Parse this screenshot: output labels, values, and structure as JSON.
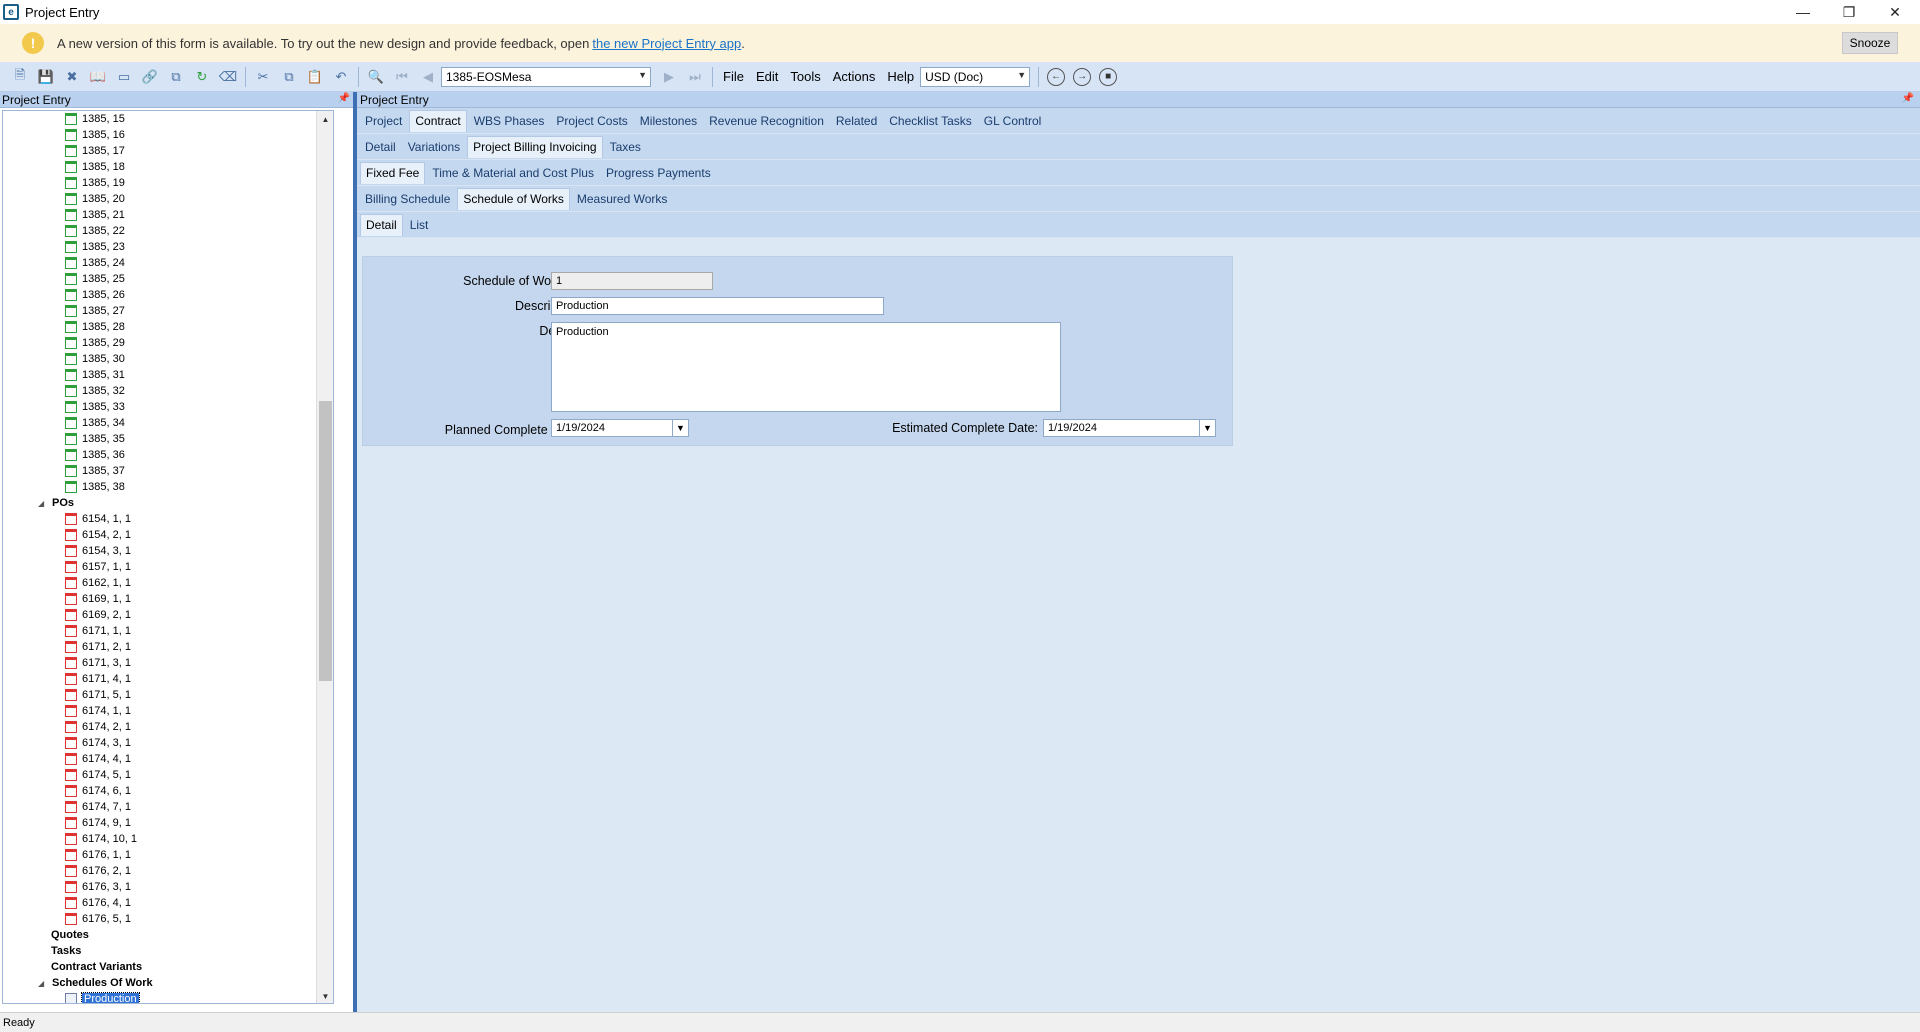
{
  "window": {
    "title": "Project Entry"
  },
  "banner": {
    "text": "A new version of this form is available. To try out the new design and provide feedback, open",
    "link": "the new Project Entry app",
    "suffix": ".",
    "snooze": "Snooze"
  },
  "toolbar": {
    "record_value": "1385-EOSMesa",
    "currency_value": "USD (Doc)",
    "menus": [
      "File",
      "Edit",
      "Tools",
      "Actions",
      "Help"
    ]
  },
  "left_pane": {
    "title": "Project Entry",
    "tree": [
      {
        "label": "1385, 15",
        "type": "green"
      },
      {
        "label": "1385, 16",
        "type": "green"
      },
      {
        "label": "1385, 17",
        "type": "green"
      },
      {
        "label": "1385, 18",
        "type": "green"
      },
      {
        "label": "1385, 19",
        "type": "green"
      },
      {
        "label": "1385, 20",
        "type": "green"
      },
      {
        "label": "1385, 21",
        "type": "green"
      },
      {
        "label": "1385, 22",
        "type": "green"
      },
      {
        "label": "1385, 23",
        "type": "green"
      },
      {
        "label": "1385, 24",
        "type": "green"
      },
      {
        "label": "1385, 25",
        "type": "green"
      },
      {
        "label": "1385, 26",
        "type": "green"
      },
      {
        "label": "1385, 27",
        "type": "green"
      },
      {
        "label": "1385, 28",
        "type": "green"
      },
      {
        "label": "1385, 29",
        "type": "green"
      },
      {
        "label": "1385, 30",
        "type": "green"
      },
      {
        "label": "1385, 31",
        "type": "green"
      },
      {
        "label": "1385, 32",
        "type": "green"
      },
      {
        "label": "1385, 33",
        "type": "green"
      },
      {
        "label": "1385, 34",
        "type": "green"
      },
      {
        "label": "1385, 35",
        "type": "green"
      },
      {
        "label": "1385, 36",
        "type": "green"
      },
      {
        "label": "1385, 37",
        "type": "green"
      },
      {
        "label": "1385, 38",
        "type": "green"
      },
      {
        "label": "POs",
        "type": "group"
      },
      {
        "label": "6154, 1, 1",
        "type": "red"
      },
      {
        "label": "6154, 2, 1",
        "type": "red"
      },
      {
        "label": "6154, 3, 1",
        "type": "red"
      },
      {
        "label": "6157, 1, 1",
        "type": "red"
      },
      {
        "label": "6162, 1, 1",
        "type": "red"
      },
      {
        "label": "6169, 1, 1",
        "type": "red"
      },
      {
        "label": "6169, 2, 1",
        "type": "red"
      },
      {
        "label": "6171, 1, 1",
        "type": "red"
      },
      {
        "label": "6171, 2, 1",
        "type": "red"
      },
      {
        "label": "6171, 3, 1",
        "type": "red"
      },
      {
        "label": "6171, 4, 1",
        "type": "red"
      },
      {
        "label": "6171, 5, 1",
        "type": "red"
      },
      {
        "label": "6174, 1, 1",
        "type": "red"
      },
      {
        "label": "6174, 2, 1",
        "type": "red"
      },
      {
        "label": "6174, 3, 1",
        "type": "red"
      },
      {
        "label": "6174, 4, 1",
        "type": "red"
      },
      {
        "label": "6174, 5, 1",
        "type": "red"
      },
      {
        "label": "6174, 6, 1",
        "type": "red"
      },
      {
        "label": "6174, 7, 1",
        "type": "red"
      },
      {
        "label": "6174, 9, 1",
        "type": "red"
      },
      {
        "label": "6174, 10, 1",
        "type": "red"
      },
      {
        "label": "6176, 1, 1",
        "type": "red"
      },
      {
        "label": "6176, 2, 1",
        "type": "red"
      },
      {
        "label": "6176, 3, 1",
        "type": "red"
      },
      {
        "label": "6176, 4, 1",
        "type": "red"
      },
      {
        "label": "6176, 5, 1",
        "type": "red"
      },
      {
        "label": "Quotes",
        "type": "node"
      },
      {
        "label": "Tasks",
        "type": "node"
      },
      {
        "label": "Contract Variants",
        "type": "node"
      },
      {
        "label": "Schedules Of Work",
        "type": "group"
      },
      {
        "label": "Production",
        "type": "selected"
      }
    ]
  },
  "right_pane": {
    "title": "Project Entry",
    "tabs_level1": [
      "Project",
      "Contract",
      "WBS Phases",
      "Project Costs",
      "Milestones",
      "Revenue Recognition",
      "Related",
      "Checklist Tasks",
      "GL Control"
    ],
    "tabs_level1_active": 1,
    "tabs_level2": [
      "Detail",
      "Variations",
      "Project Billing Invoicing",
      "Taxes"
    ],
    "tabs_level2_active": 2,
    "tabs_level3": [
      "Fixed Fee",
      "Time & Material and Cost Plus",
      "Progress Payments"
    ],
    "tabs_level3_active": 0,
    "tabs_level4": [
      "Billing Schedule",
      "Schedule of Works",
      "Measured Works"
    ],
    "tabs_level4_active": 1,
    "tabs_level5": [
      "Detail",
      "List"
    ],
    "tabs_level5_active": 0
  },
  "form": {
    "sow_id_label": "Schedule of Work ID:",
    "sow_id_value": "1",
    "description_label": "Description:",
    "description_value": "Production",
    "details_label": "Details:",
    "details_value": "Production",
    "planned_label": "Planned Complete Date:",
    "planned_value": "1/19/2024",
    "estimated_label": "Estimated Complete Date:",
    "estimated_value": "1/19/2024"
  },
  "status": {
    "text": "Ready"
  }
}
